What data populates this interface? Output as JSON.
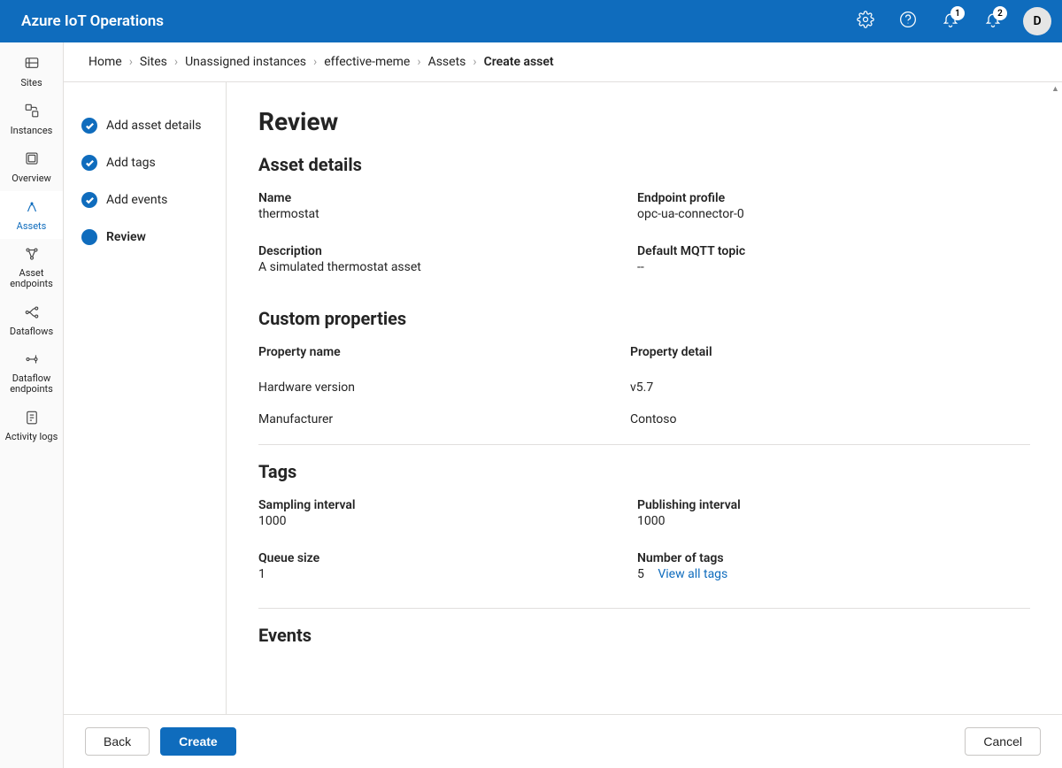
{
  "header": {
    "brand": "Azure IoT Operations",
    "avatar_initial": "D",
    "alert_badge": "1",
    "notification_badge": "2"
  },
  "left_nav": {
    "items": [
      {
        "label": "Sites"
      },
      {
        "label": "Instances"
      },
      {
        "label": "Overview"
      },
      {
        "label": "Assets"
      },
      {
        "label": "Asset endpoints"
      },
      {
        "label": "Dataflows"
      },
      {
        "label": "Dataflow endpoints"
      },
      {
        "label": "Activity logs"
      }
    ]
  },
  "breadcrumbs": [
    "Home",
    "Sites",
    "Unassigned instances",
    "effective-meme",
    "Assets",
    "Create asset"
  ],
  "wizard": {
    "steps": [
      {
        "label": "Add asset details",
        "state": "completed"
      },
      {
        "label": "Add tags",
        "state": "completed"
      },
      {
        "label": "Add events",
        "state": "completed"
      },
      {
        "label": "Review",
        "state": "current"
      }
    ]
  },
  "page_title": "Review",
  "sections": {
    "asset_details": {
      "heading": "Asset details",
      "name_label": "Name",
      "name_value": "thermostat",
      "endpoint_label": "Endpoint profile",
      "endpoint_value": "opc-ua-connector-0",
      "description_label": "Description",
      "description_value": "A simulated thermostat asset",
      "mqtt_label": "Default MQTT topic",
      "mqtt_value": "--"
    },
    "custom_props": {
      "heading": "Custom properties",
      "col_name": "Property name",
      "col_detail": "Property detail",
      "rows": [
        {
          "name": "Hardware version",
          "detail": "v5.7"
        },
        {
          "name": "Manufacturer",
          "detail": "Contoso"
        }
      ]
    },
    "tags": {
      "heading": "Tags",
      "sampling_label": "Sampling interval",
      "sampling_value": "1000",
      "publishing_label": "Publishing interval",
      "publishing_value": "1000",
      "queue_label": "Queue size",
      "queue_value": "1",
      "count_label": "Number of tags",
      "count_value": "5",
      "view_all": "View all tags"
    },
    "events": {
      "heading": "Events"
    }
  },
  "footer": {
    "back": "Back",
    "create": "Create",
    "cancel": "Cancel"
  }
}
